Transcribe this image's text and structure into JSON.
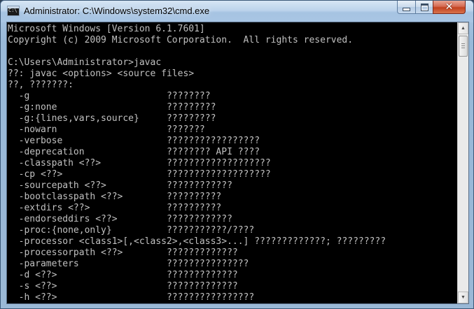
{
  "window": {
    "title": "Administrator: C:\\Windows\\system32\\cmd.exe",
    "icon_text": "C:\\",
    "icons": {
      "app": "cmd-app-icon",
      "minimize": "minimize-icon",
      "maximize": "maximize-icon",
      "close": "close-icon"
    }
  },
  "colors": {
    "console_bg": "#000000",
    "console_fg": "#c0c0c0",
    "close_button": "#c2411f"
  },
  "console": {
    "lines": [
      "Microsoft Windows [Version 6.1.7601]",
      "Copyright (c) 2009 Microsoft Corporation.  All rights reserved.",
      "",
      "C:\\Users\\Administrator>javac",
      "??: javac <options> <source files>",
      "??, ???????:",
      "  -g                         ????????",
      "  -g:none                    ?????????",
      "  -g:{lines,vars,source}     ?????????",
      "  -nowarn                    ???????",
      "  -verbose                   ?????????????????",
      "  -deprecation               ???????? API ????",
      "  -classpath <??>            ???????????????????",
      "  -cp <??>                   ???????????????????",
      "  -sourcepath <??>           ????????????",
      "  -bootclasspath <??>        ??????????",
      "  -extdirs <??>              ??????????",
      "  -endorseddirs <??>         ????????????",
      "  -proc:{none,only}          ???????????/????",
      "  -processor <class1>[,<class2>,<class3>...] ?????????????; ?????????",
      "  -processorpath <??>        ?????????????",
      "  -parameters                ???????????????",
      "  -d <??>                    ?????????????",
      "  -s <??>                    ?????????????",
      "  -h <??>                    ????????????????"
    ]
  },
  "scrollbar": {
    "up_glyph": "▲",
    "down_glyph": "▼"
  }
}
